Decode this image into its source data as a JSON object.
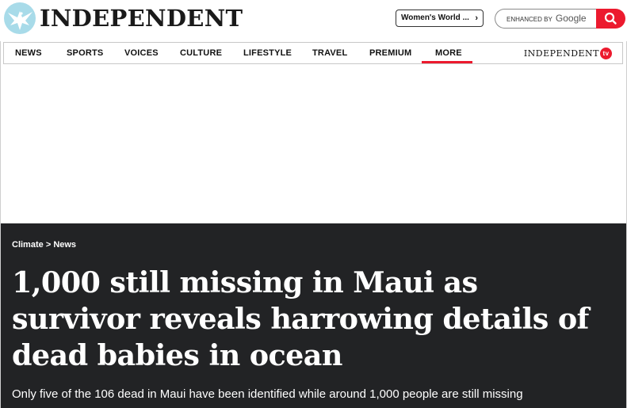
{
  "masthead": {
    "brand": "INDEPENDENT",
    "promo_label": "Women's World ...",
    "search_prefix": "ENHANCED BY",
    "search_brand": "Google"
  },
  "nav": {
    "items": [
      {
        "label": "NEWS"
      },
      {
        "label": "SPORTS"
      },
      {
        "label": "VOICES"
      },
      {
        "label": "CULTURE"
      },
      {
        "label": "LIFESTYLE"
      },
      {
        "label": "TRAVEL"
      },
      {
        "label": "PREMIUM"
      },
      {
        "label": "MORE"
      }
    ],
    "tv_brand": "INDEPENDENT",
    "tv_badge": "tv"
  },
  "article": {
    "breadcrumb": [
      "Climate",
      "News"
    ],
    "breadcrumb_sep": ">",
    "headline": "1,000 still missing in Maui as survivor reveals harrowing details of dead babies in ocean",
    "standfirst": "Only five of the 106 dead in Maui have been identified while around 1,000 people are still missing"
  },
  "colors": {
    "accent": "#ec1a2e",
    "hero_bg": "#222325",
    "eagle": "#9fd3e6"
  },
  "icons": [
    "eagle-logo-icon",
    "chevron-right-icon",
    "search-icon"
  ]
}
